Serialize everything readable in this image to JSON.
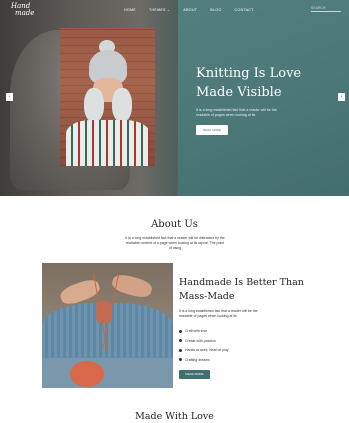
{
  "brand": {
    "logo_line1": "Hand",
    "logo_line2": "made"
  },
  "nav": {
    "items": [
      "HOME",
      "THEMES ⌄",
      "ABOUT",
      "BLOG",
      "CONTACT"
    ],
    "search_placeholder": "SEARCH"
  },
  "hero": {
    "title_line1": "Knitting Is Love",
    "title_line2": "Made Visible",
    "subtitle": "It is a long established fact that a reader will be the readable of pages when looking at its",
    "button": "READ MORE",
    "prev_arrow": "‹",
    "next_arrow": "›"
  },
  "about": {
    "title": "About Us",
    "text": "It is a long established fact that a reader will be distracted by the readable content of a page when looking at its layout. The point of using"
  },
  "handmade": {
    "title_line1": "Handmade Is Better Than",
    "title_line2": "Mass-Made",
    "subtitle": "It is a long established fact that a reader will be the readable of pages when looking at its",
    "list": [
      "Craft with love",
      "Create with passion",
      "Hands at work, heart at play",
      "Crafting dreams"
    ],
    "button": "READ MORE"
  },
  "made": {
    "title": "Made With Love"
  },
  "colors": {
    "teal": "#4b7776",
    "button_dark": "#3f6f6f"
  }
}
